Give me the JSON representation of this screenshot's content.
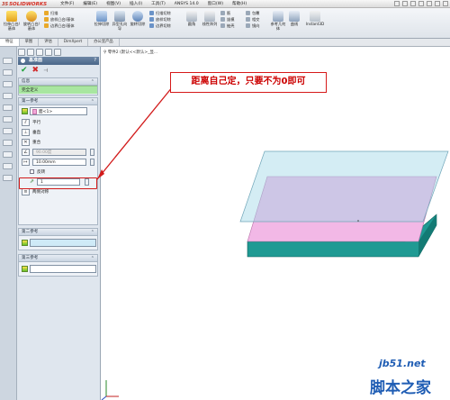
{
  "app": {
    "logo_prefix": "3S",
    "logo_text": "SOLIDWORKS"
  },
  "menu": [
    "文件(F)",
    "编辑(E)",
    "视图(V)",
    "插入(I)",
    "工具(T)",
    "ANSYS 14.0",
    "窗口(W)",
    "帮助(H)"
  ],
  "ribbon": {
    "boss_extrude": "拉伸凸台/基体",
    "revolve_boss": "旋转凸台/基体",
    "sweep": "扫描",
    "loft_boss": "放样凸台/基体",
    "boundary_boss": "边界凸台/基体",
    "cut_extrude": "拉伸切除",
    "hole_wizard": "异型孔向导",
    "revolve_cut": "旋转切除",
    "sweep_cut": "扫描切除",
    "loft_cut": "放样切除",
    "boundary_cut": "边界切除",
    "fillet": "圆角",
    "linear_pattern": "线性阵列",
    "rib": "筋",
    "draft": "拔模",
    "shell": "抽壳",
    "wrap": "包覆",
    "intersect": "相交",
    "mirror": "镜向",
    "reference_geometry": "参考几何体",
    "curves": "曲线",
    "instant3d": "Instant3D"
  },
  "tabs": [
    "特征",
    "草图",
    "评估",
    "DimXpert",
    "办公室产品"
  ],
  "tree": {
    "text": "零件2 (默认<<默认>_显..."
  },
  "pm": {
    "title": "基准面",
    "help": "?",
    "message_header": "信息",
    "message": "完全定义",
    "first_ref_header": "第一参考",
    "first_ref_value": "面<1>",
    "parallel": "平行",
    "perpendicular": "垂直",
    "coincident": "重合",
    "angle_value": "90.00度",
    "distance_value": "10.00mm",
    "flip": "反转",
    "count_value": "1",
    "mid_plane": "两侧对称",
    "second_ref_header": "第二参考",
    "third_ref_header": "第三参考"
  },
  "callout": {
    "text": "距离自己定，只要不为0即可"
  },
  "watermark": {
    "site": "jb51.net",
    "name": "脚本之家"
  },
  "colors": {
    "accent_red": "#d21a1a",
    "message_green": "#a8e6a0",
    "plane_blue": "#bfe6ef",
    "face_pink": "#f2b8e6",
    "body_teal": "#1f9a93"
  }
}
